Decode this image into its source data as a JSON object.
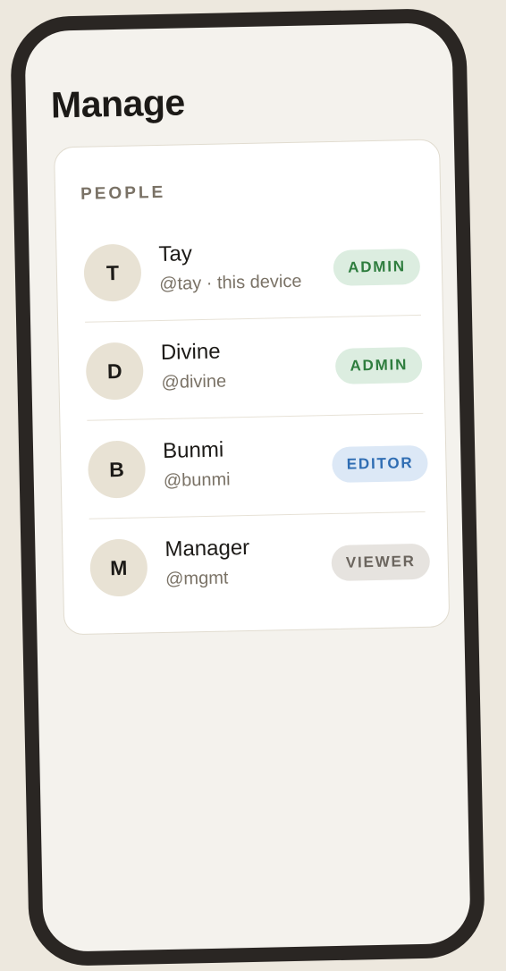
{
  "page": {
    "title": "Manage"
  },
  "people": {
    "section_label": "PEOPLE",
    "items": [
      {
        "initial": "T",
        "name": "Tay",
        "handle": "@tay · this device",
        "role": "ADMIN"
      },
      {
        "initial": "D",
        "name": "Divine",
        "handle": "@divine",
        "role": "ADMIN"
      },
      {
        "initial": "B",
        "name": "Bunmi",
        "handle": "@bunmi",
        "role": "EDITOR"
      },
      {
        "initial": "M",
        "name": "Manager",
        "handle": "@mgmt",
        "role": "VIEWER"
      }
    ]
  },
  "colors": {
    "background": "#ede8de",
    "phone_frame": "#2a2623",
    "screen": "#f4f2ed",
    "card": "#ffffff",
    "avatar": "#e8e2d4",
    "admin_badge_bg": "#dcede0",
    "admin_badge_text": "#2e7d3e",
    "editor_badge_bg": "#dce8f6",
    "editor_badge_text": "#2f6db3",
    "viewer_badge_bg": "#e6e3df",
    "viewer_badge_text": "#6b655e"
  }
}
